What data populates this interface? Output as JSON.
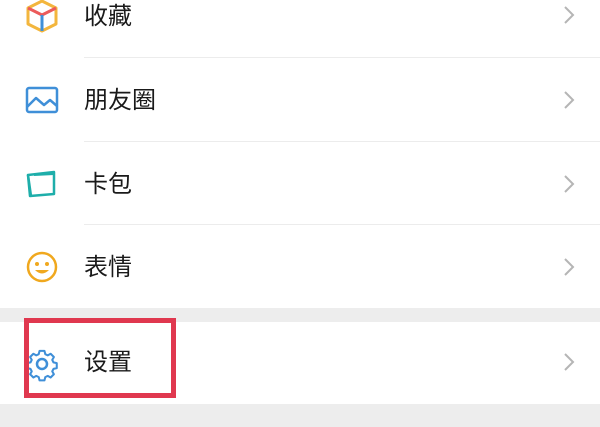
{
  "menu": {
    "items": [
      {
        "label": "收藏",
        "icon": "cube-icon"
      },
      {
        "label": "朋友圈",
        "icon": "image-icon"
      },
      {
        "label": "卡包",
        "icon": "card-wallet-icon"
      },
      {
        "label": "表情",
        "icon": "smiley-icon"
      },
      {
        "label": "设置",
        "icon": "gear-icon"
      }
    ]
  },
  "colors": {
    "background": "#ededed",
    "surface": "#ffffff",
    "highlight": "#e0384f",
    "blue": "#3f8fd8",
    "teal": "#1eaeaa",
    "gold": "#f0a81e"
  }
}
